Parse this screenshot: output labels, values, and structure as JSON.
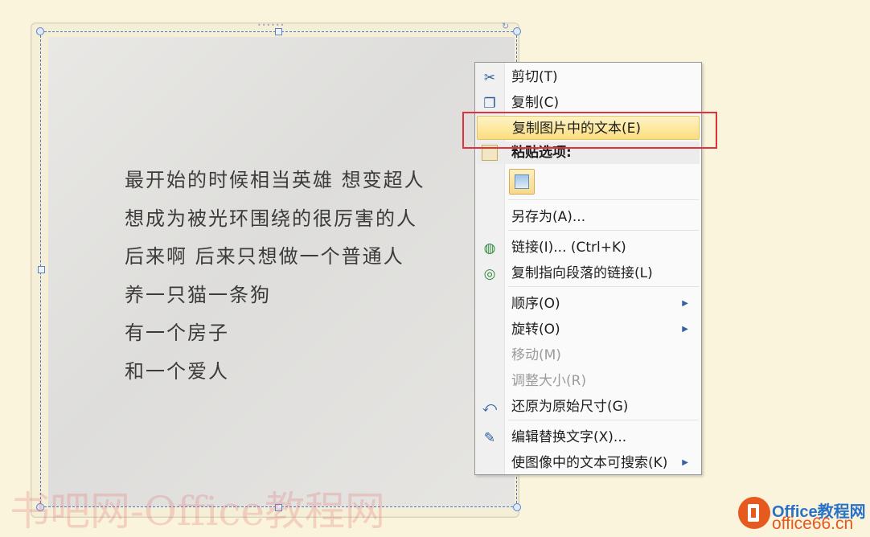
{
  "poem": {
    "lines": [
      "最开始的时候相当英雄 想变超人",
      "想成为被光环围绕的很厉害的人",
      "后来啊 后来只想做一个普通人",
      "养一只猫一条狗",
      "有一个房子",
      "和一个爱人"
    ]
  },
  "menu": {
    "cut": "剪切(T)",
    "copy": "复制(C)",
    "copy_text_from_picture": "复制图片中的文本(E)",
    "paste_options": "粘贴选项:",
    "save_as": "另存为(A)...",
    "link": "链接(I)... (Ctrl+K)",
    "copy_link_to_paragraph": "复制指向段落的链接(L)",
    "order": "顺序(O)",
    "rotate": "旋转(O)",
    "move": "移动(M)",
    "resize": "调整大小(R)",
    "restore_original_size": "还原为原始尺寸(G)",
    "edit_alt_text": "编辑替换文字(X)...",
    "make_text_searchable": "使图像中的文本可搜索(K)"
  },
  "icons": {
    "cut": "scissors-icon",
    "copy": "copy-icon",
    "paste": "clipboard-icon",
    "paste_picture": "picture-icon",
    "link": "globe-link-icon",
    "copy_link": "paragraph-link-icon",
    "restore": "restore-size-icon",
    "alt_text": "alt-text-icon",
    "submenu": "chevron-right-icon"
  },
  "watermarks": {
    "left": "书吧网-Office教程网",
    "site_name": "Office教程网",
    "site_url": "office66.cn"
  },
  "colors": {
    "page_background": "#fbf4dc",
    "highlight_fill": "#fde9a0",
    "callout_red": "#e0323a",
    "selection_blue": "#4a78c2"
  }
}
